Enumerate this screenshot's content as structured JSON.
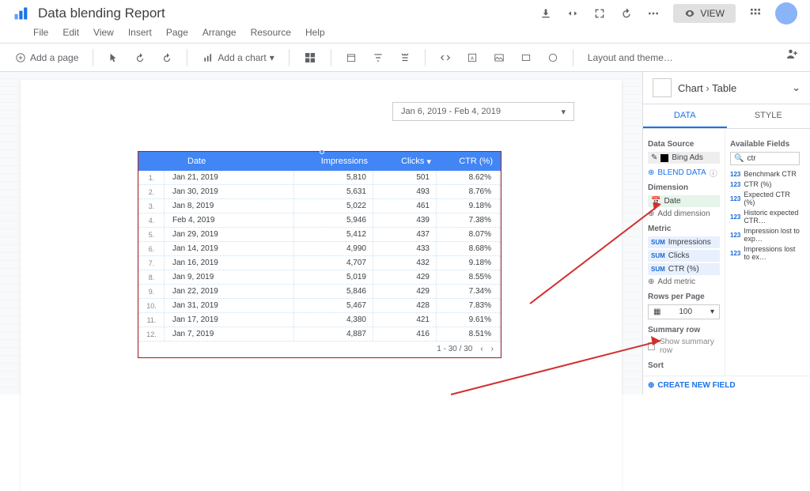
{
  "header": {
    "doc_title": "Data blending Report",
    "view_label": "VIEW"
  },
  "menubar": [
    "File",
    "Edit",
    "View",
    "Insert",
    "Page",
    "Arrange",
    "Resource",
    "Help"
  ],
  "toolbar": {
    "add_page": "Add a page",
    "add_chart": "Add a chart",
    "layout_theme": "Layout and theme…"
  },
  "date_range": "Jan 6, 2019 - Feb 4, 2019",
  "table": {
    "headers": {
      "date": "Date",
      "impressions": "Impressions",
      "clicks": "Clicks",
      "ctr": "CTR (%)"
    },
    "rows": [
      {
        "i": "1.",
        "date": "Jan 21, 2019",
        "imp": "5,810",
        "clk": "501",
        "ctr": "8.62%"
      },
      {
        "i": "2.",
        "date": "Jan 30, 2019",
        "imp": "5,631",
        "clk": "493",
        "ctr": "8.76%"
      },
      {
        "i": "3.",
        "date": "Jan 8, 2019",
        "imp": "5,022",
        "clk": "461",
        "ctr": "9.18%"
      },
      {
        "i": "4.",
        "date": "Feb 4, 2019",
        "imp": "5,946",
        "clk": "439",
        "ctr": "7.38%"
      },
      {
        "i": "5.",
        "date": "Jan 29, 2019",
        "imp": "5,412",
        "clk": "437",
        "ctr": "8.07%"
      },
      {
        "i": "6.",
        "date": "Jan 14, 2019",
        "imp": "4,990",
        "clk": "433",
        "ctr": "8.68%"
      },
      {
        "i": "7.",
        "date": "Jan 16, 2019",
        "imp": "4,707",
        "clk": "432",
        "ctr": "9.18%"
      },
      {
        "i": "8.",
        "date": "Jan 9, 2019",
        "imp": "5,019",
        "clk": "429",
        "ctr": "8.55%"
      },
      {
        "i": "9.",
        "date": "Jan 22, 2019",
        "imp": "5,846",
        "clk": "429",
        "ctr": "7.34%"
      },
      {
        "i": "10.",
        "date": "Jan 31, 2019",
        "imp": "5,467",
        "clk": "428",
        "ctr": "7.83%"
      },
      {
        "i": "11.",
        "date": "Jan 17, 2019",
        "imp": "4,380",
        "clk": "421",
        "ctr": "9.61%"
      },
      {
        "i": "12.",
        "date": "Jan 7, 2019",
        "imp": "4,887",
        "clk": "416",
        "ctr": "8.51%"
      }
    ],
    "pager": "1 - 30 / 30"
  },
  "panel": {
    "bc_chart": "Chart",
    "bc_table": "Table",
    "tab_data": "DATA",
    "tab_style": "STYLE",
    "data_source_title": "Data Source",
    "data_source_name": "Bing Ads",
    "blend_label": "BLEND DATA",
    "dimension_title": "Dimension",
    "dim_date": "Date",
    "add_dimension": "Add dimension",
    "metric_title": "Metric",
    "met_imp": "Impressions",
    "met_clk": "Clicks",
    "met_ctr": "CTR (%)",
    "add_metric": "Add metric",
    "rpp_title": "Rows per Page",
    "rpp_value": "100",
    "summary_title": "Summary row",
    "summary_label": "Show summary row",
    "sort_title": "Sort",
    "available_title": "Available Fields",
    "search_value": "ctr",
    "fields": [
      "Benchmark CTR",
      "CTR (%)",
      "Expected CTR (%)",
      "Historic expected CTR…",
      "Impression lost to exp…",
      "Impressions lost to ex…"
    ],
    "create_field": "CREATE NEW FIELD"
  }
}
